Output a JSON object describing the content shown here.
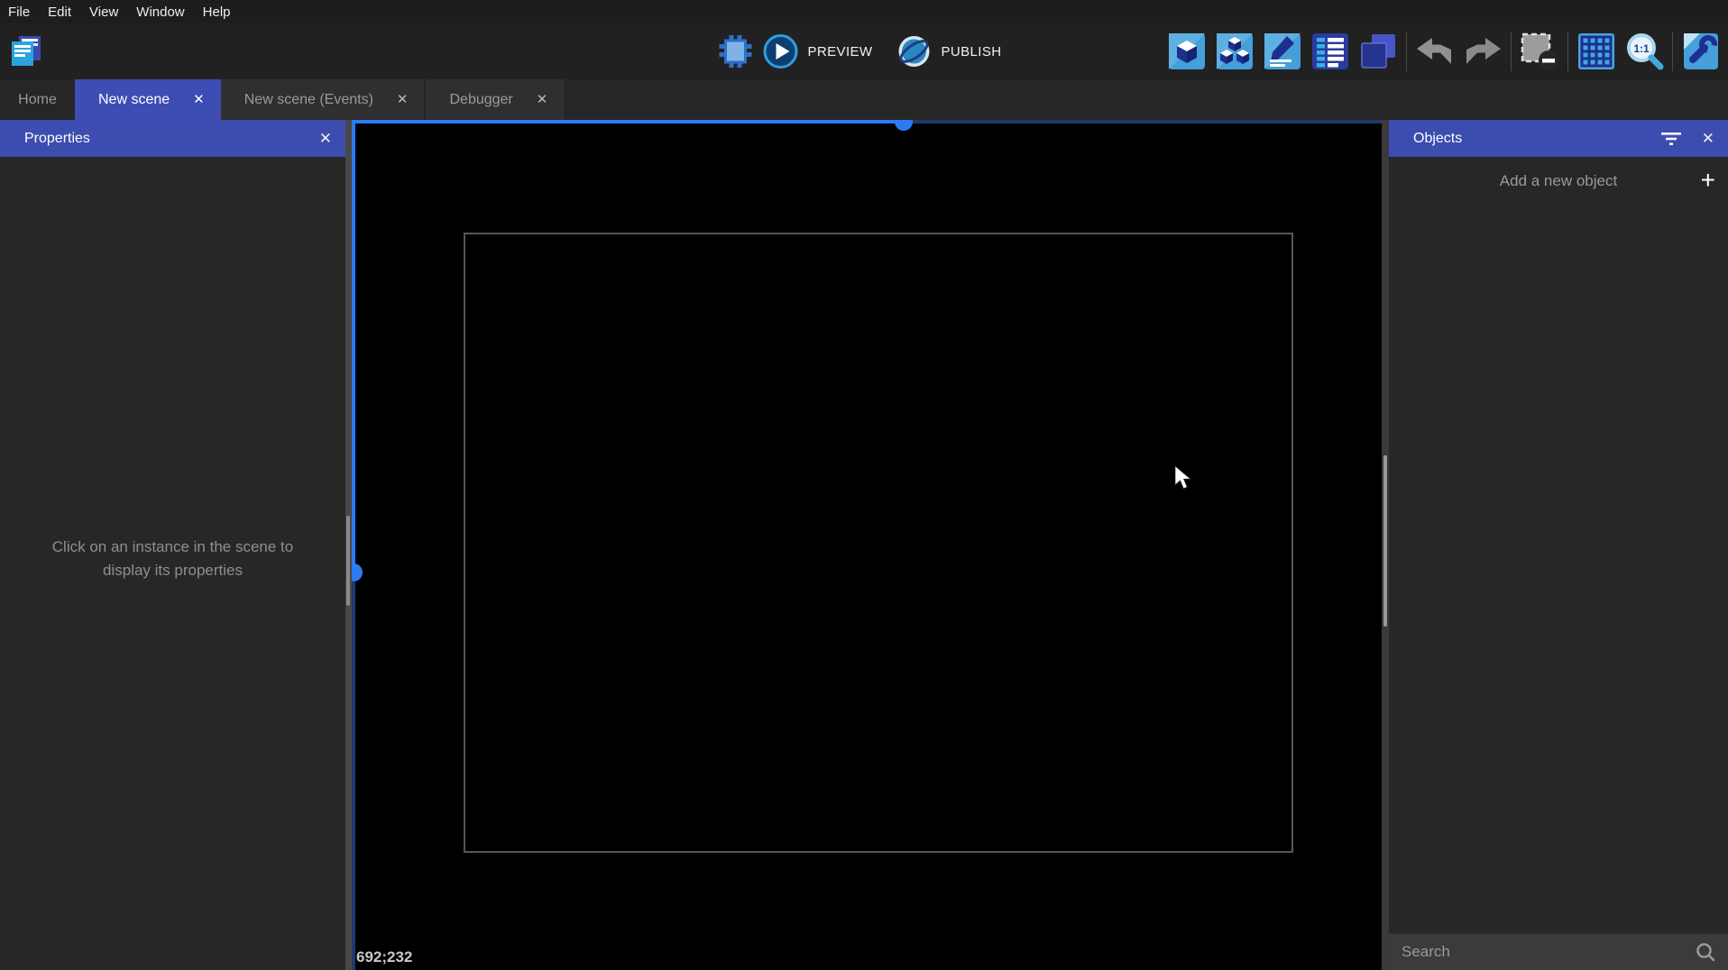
{
  "menu": {
    "items": [
      "File",
      "Edit",
      "View",
      "Window",
      "Help"
    ]
  },
  "toolbar": {
    "preview_label": "PREVIEW",
    "publish_label": "PUBLISH",
    "zoom_ratio_label": "1:1",
    "icon_names": [
      "project-manager-icon",
      "debug-icon",
      "play-icon",
      "globe-icon",
      "scene-objects-icon",
      "object-groups-icon",
      "edit-properties-icon",
      "instances-list-icon",
      "layers-icon",
      "undo-icon",
      "redo-icon",
      "delete-selection-icon",
      "grid-icon",
      "zoom-1-1-icon",
      "scene-settings-icon"
    ]
  },
  "tabs": {
    "close_glyph": "✕",
    "items": [
      {
        "label": "Home",
        "active": false,
        "closable": false
      },
      {
        "label": "New scene",
        "active": true,
        "closable": true
      },
      {
        "label": "New scene (Events)",
        "active": false,
        "closable": true
      },
      {
        "label": "Debugger",
        "active": false,
        "closable": true
      }
    ]
  },
  "properties_panel": {
    "title": "Properties",
    "close_glyph": "✕",
    "empty_message": "Click on an instance in the scene to display its properties"
  },
  "scene_canvas": {
    "cursor_coordinates": "692;232"
  },
  "objects_panel": {
    "title": "Objects",
    "close_glyph": "✕",
    "add_button_label": "Add a new object",
    "add_button_glyph": "+",
    "search_placeholder": "Search"
  },
  "colors": {
    "accent_indigo": "#3C4DB3",
    "scrollbar_active_blue": "#2D7AF5",
    "scrollbar_inactive_blue": "#1C3A6D",
    "icon_light_blue": "#459FD8",
    "icon_navy": "#1D2F91",
    "canvas_background": "#000000"
  }
}
